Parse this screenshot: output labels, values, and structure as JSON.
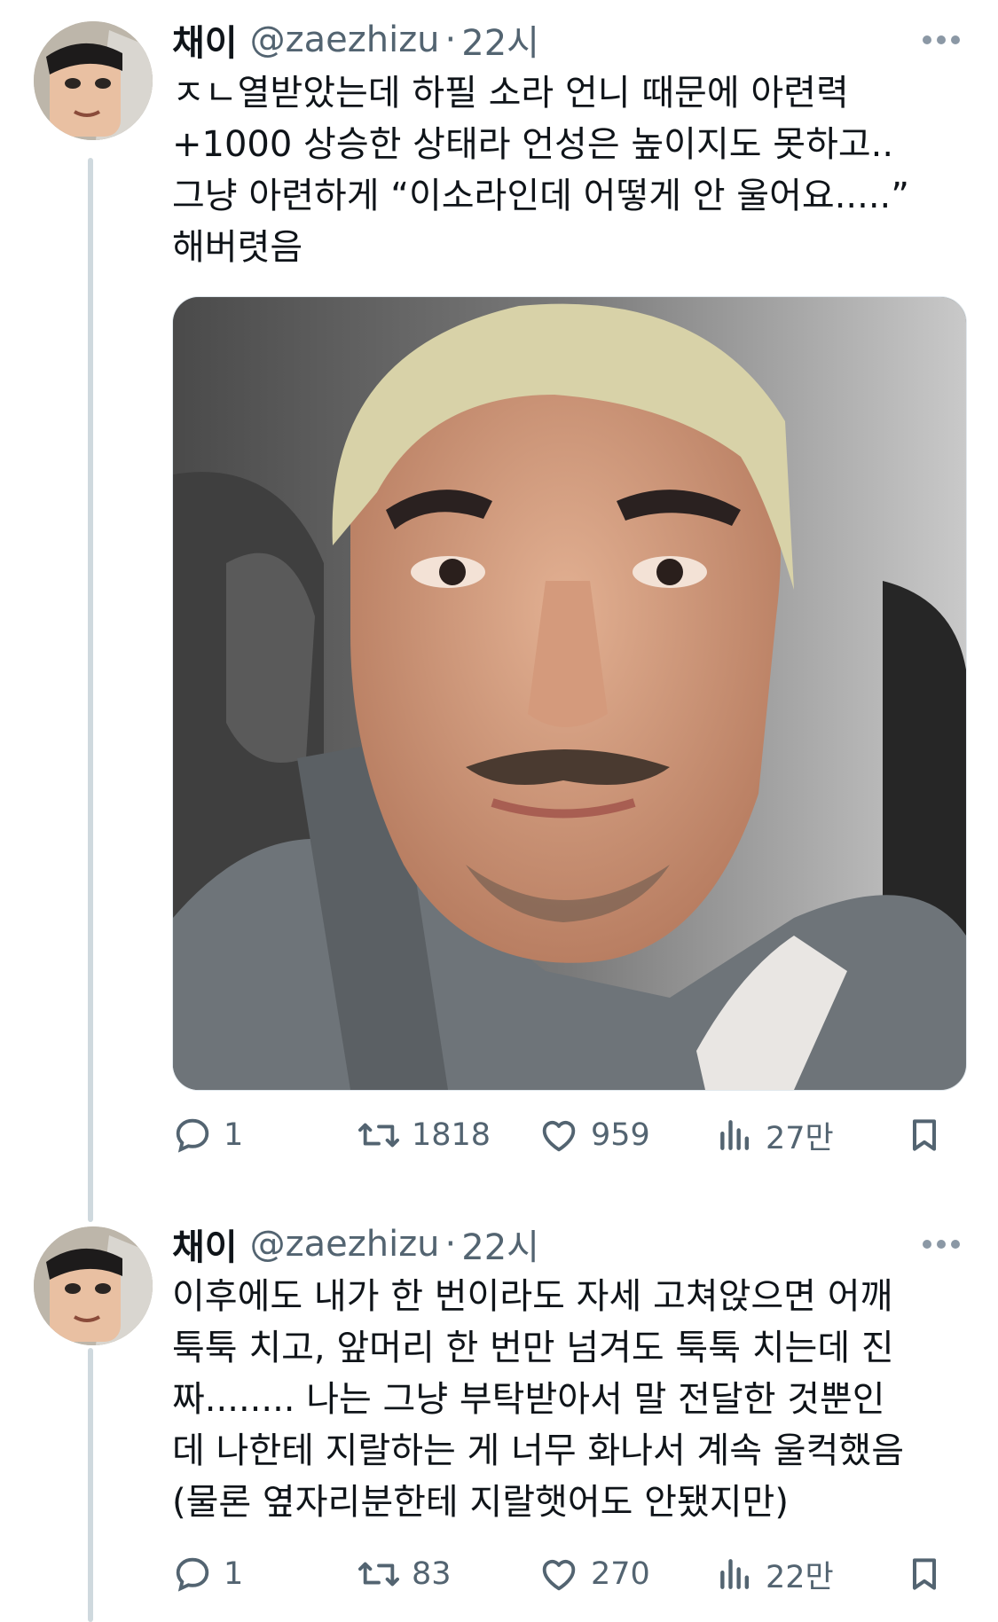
{
  "tweets": [
    {
      "name": "채이",
      "handle": "@zaezhizu",
      "separator": "·",
      "time": "22시",
      "lines": [
        "ㅈㄴ열받았는데 하필 소라 언니 때문에 아련력",
        "+1000 상승한 상태라 언성은 높이지도 못하고..",
        "그냥 아련하게 “이소라인데 어떻게 안 울어요.....”",
        "해버렷음"
      ],
      "replies": "1",
      "retweets": "1818",
      "likes": "959",
      "views": "27만"
    },
    {
      "name": "채이",
      "handle": "@zaezhizu",
      "separator": "·",
      "time": "22시",
      "lines": [
        "이후에도 내가 한 번이라도 자세 고쳐앉으면 어깨",
        "툭툭 치고, 앞머리 한 번만 넘겨도 툭툭 치는데 진",
        "짜........ 나는 그냥 부탁받아서 말 전달한 것뿐인",
        "데 나한테 지랄하는 게 너무 화나서 계속 울컥했음",
        "(물론 옆자리분한테 지랄햇어도 안됐지만)"
      ],
      "replies": "1",
      "retweets": "83",
      "likes": "270",
      "views": "22만"
    }
  ],
  "icons": {
    "reply": "reply-icon",
    "retweet": "retweet-icon",
    "like": "heart-icon",
    "views": "views-icon",
    "bookmark": "bookmark-icon",
    "more": "more-icon"
  },
  "colors": {
    "text": "#0f1419",
    "secondary": "#536471",
    "thread_line": "#cfd9de"
  }
}
